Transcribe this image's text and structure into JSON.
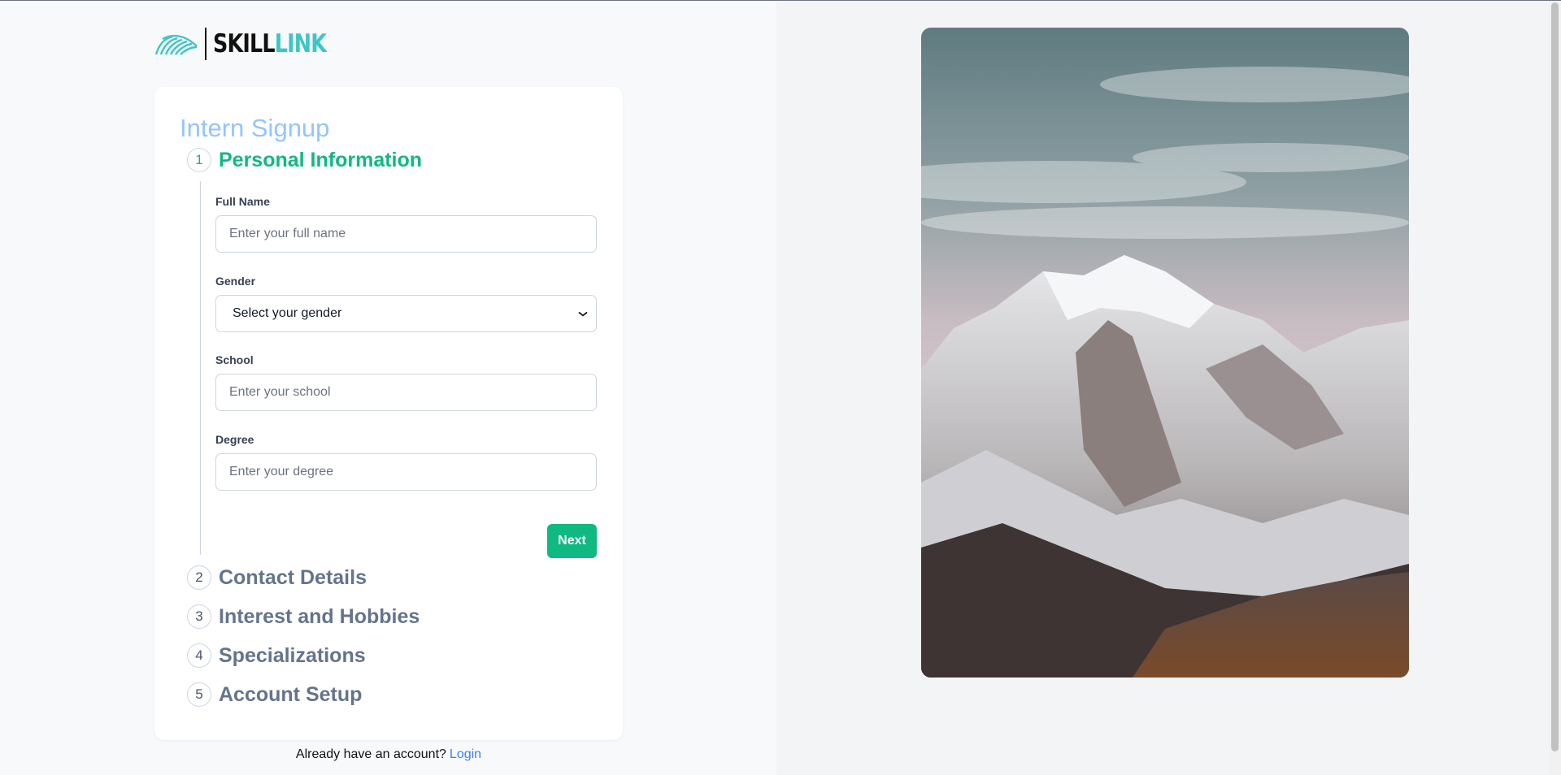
{
  "logo": {
    "text_dark": "SKILL",
    "text_accent": "LINK",
    "icon": "waves-logo-icon",
    "accent_color": "#3cc6c6"
  },
  "form": {
    "title": "Intern Signup",
    "steps": [
      {
        "number": "1",
        "label": "Personal Information",
        "active": true
      },
      {
        "number": "2",
        "label": "Contact Details",
        "active": false
      },
      {
        "number": "3",
        "label": "Interest and Hobbies",
        "active": false
      },
      {
        "number": "4",
        "label": "Specializations",
        "active": false
      },
      {
        "number": "5",
        "label": "Account Setup",
        "active": false
      }
    ],
    "fields": {
      "full_name": {
        "label": "Full Name",
        "placeholder": "Enter your full name",
        "value": ""
      },
      "gender": {
        "label": "Gender",
        "selected": "Select your gender",
        "icon": "chevron-down-icon"
      },
      "school": {
        "label": "School",
        "placeholder": "Enter your school",
        "value": ""
      },
      "degree": {
        "label": "Degree",
        "placeholder": "Enter your degree",
        "value": ""
      }
    },
    "next_label": "Next"
  },
  "login": {
    "prompt": "Already have an account?",
    "link_label": "Login"
  },
  "colors": {
    "primary": "#10b981",
    "title": "#93c5fd",
    "link": "#3b82f6"
  },
  "image": {
    "subject": "snowy-mountain-photo"
  }
}
